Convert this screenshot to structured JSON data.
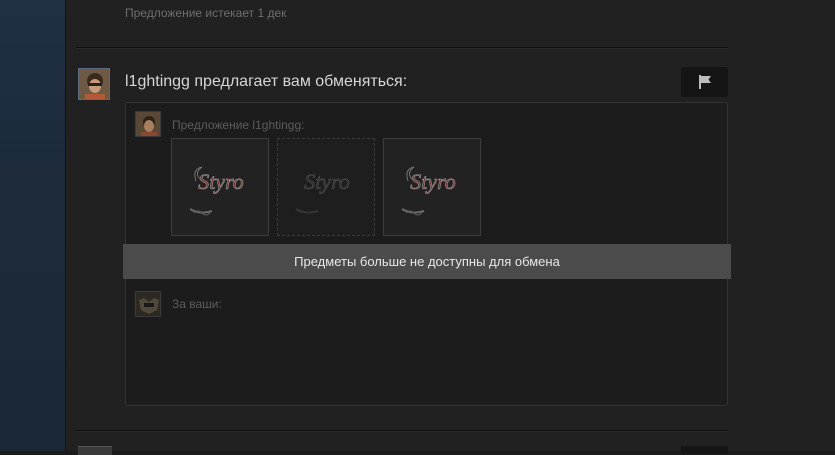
{
  "previous_offer": {
    "expires_text": "Предложение истекает 1 дек"
  },
  "offer": {
    "headline": "l1ghtingg предлагает вам обменяться:",
    "their_label": "Предложение l1ghtingg:",
    "your_label": "За ваши:",
    "unavailable_notice": "Предметы больше не доступны для обмена",
    "items": [
      {
        "name": "Styro",
        "state": "unavailable"
      },
      {
        "name": "Styro",
        "state": "missing"
      },
      {
        "name": "Styro",
        "state": "unavailable"
      }
    ]
  },
  "icons": {
    "report": "flag-icon"
  },
  "colors": {
    "page_bg": "#212121",
    "notice_bg": "#4b4b4b",
    "sidebar": "#1b2838"
  }
}
